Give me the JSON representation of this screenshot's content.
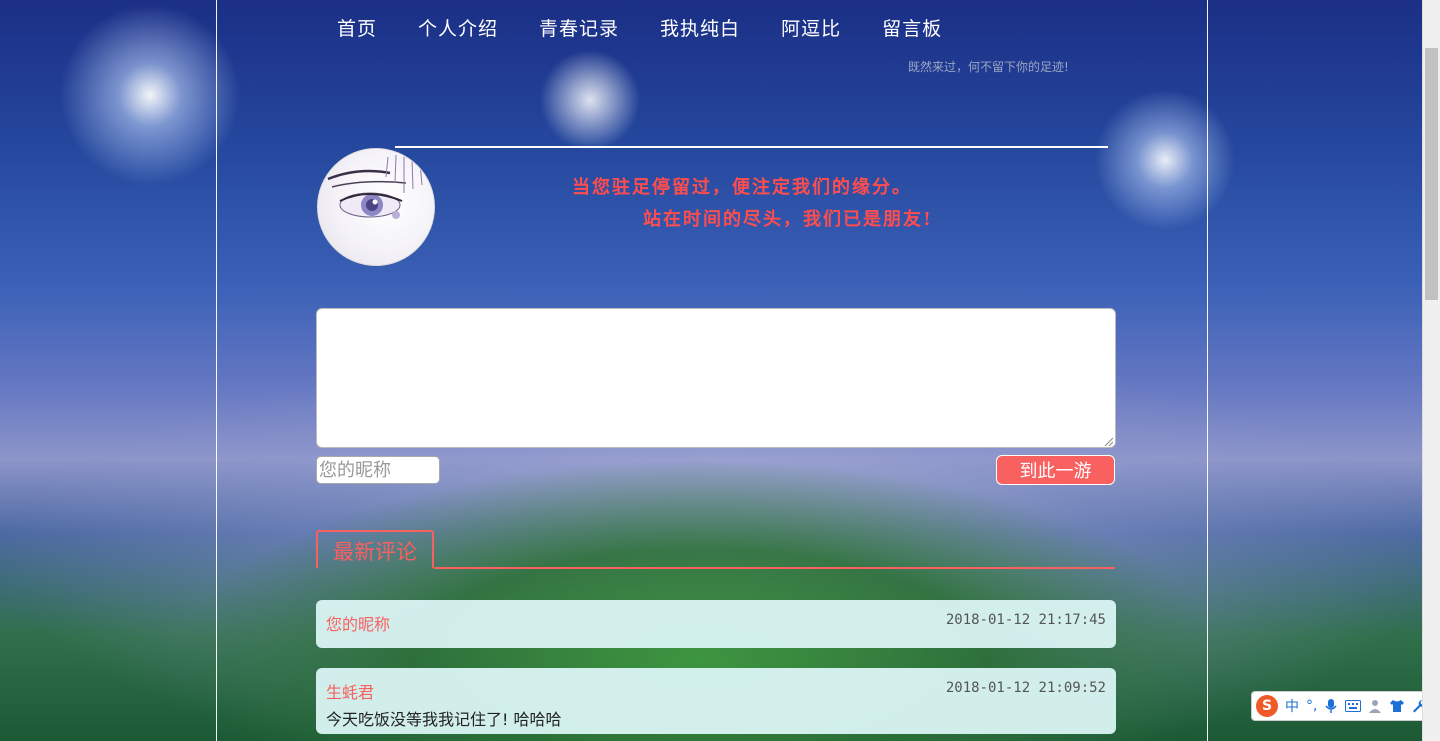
{
  "nav": {
    "items": [
      {
        "label": "首页"
      },
      {
        "label": "个人介绍"
      },
      {
        "label": "青春记录"
      },
      {
        "label": "我执纯白"
      },
      {
        "label": "阿逗比"
      },
      {
        "label": "留言板"
      }
    ]
  },
  "header": {
    "tagline": "既然来过，何不留下你的足迹!"
  },
  "banner": {
    "line1": "当您驻足停留过，便注定我们的缘分。",
    "line2": "站在时间的尽头，我们已是朋友!"
  },
  "form": {
    "message_value": "",
    "nickname_placeholder": "您的昵称",
    "submit_label": "到此一游"
  },
  "comments": {
    "section_title": "最新评论",
    "items": [
      {
        "name": "您的昵称",
        "time": "2018-01-12 21:17:45",
        "text": ""
      },
      {
        "name": "生蚝君",
        "time": "2018-01-12 21:09:52",
        "text": "今天吃饭没等我我记住了! 哈哈哈"
      }
    ]
  },
  "ime": {
    "logo": "S",
    "items": [
      "中",
      "°,",
      "mic-icon",
      "keyboard-icon",
      "user-icon",
      "shirt-icon",
      "wrench-icon"
    ]
  },
  "colors": {
    "accent": "#f96060",
    "quote": "#ff4d4d",
    "card_bg": "#d8f4f3",
    "nav_text": "#ffffff"
  }
}
